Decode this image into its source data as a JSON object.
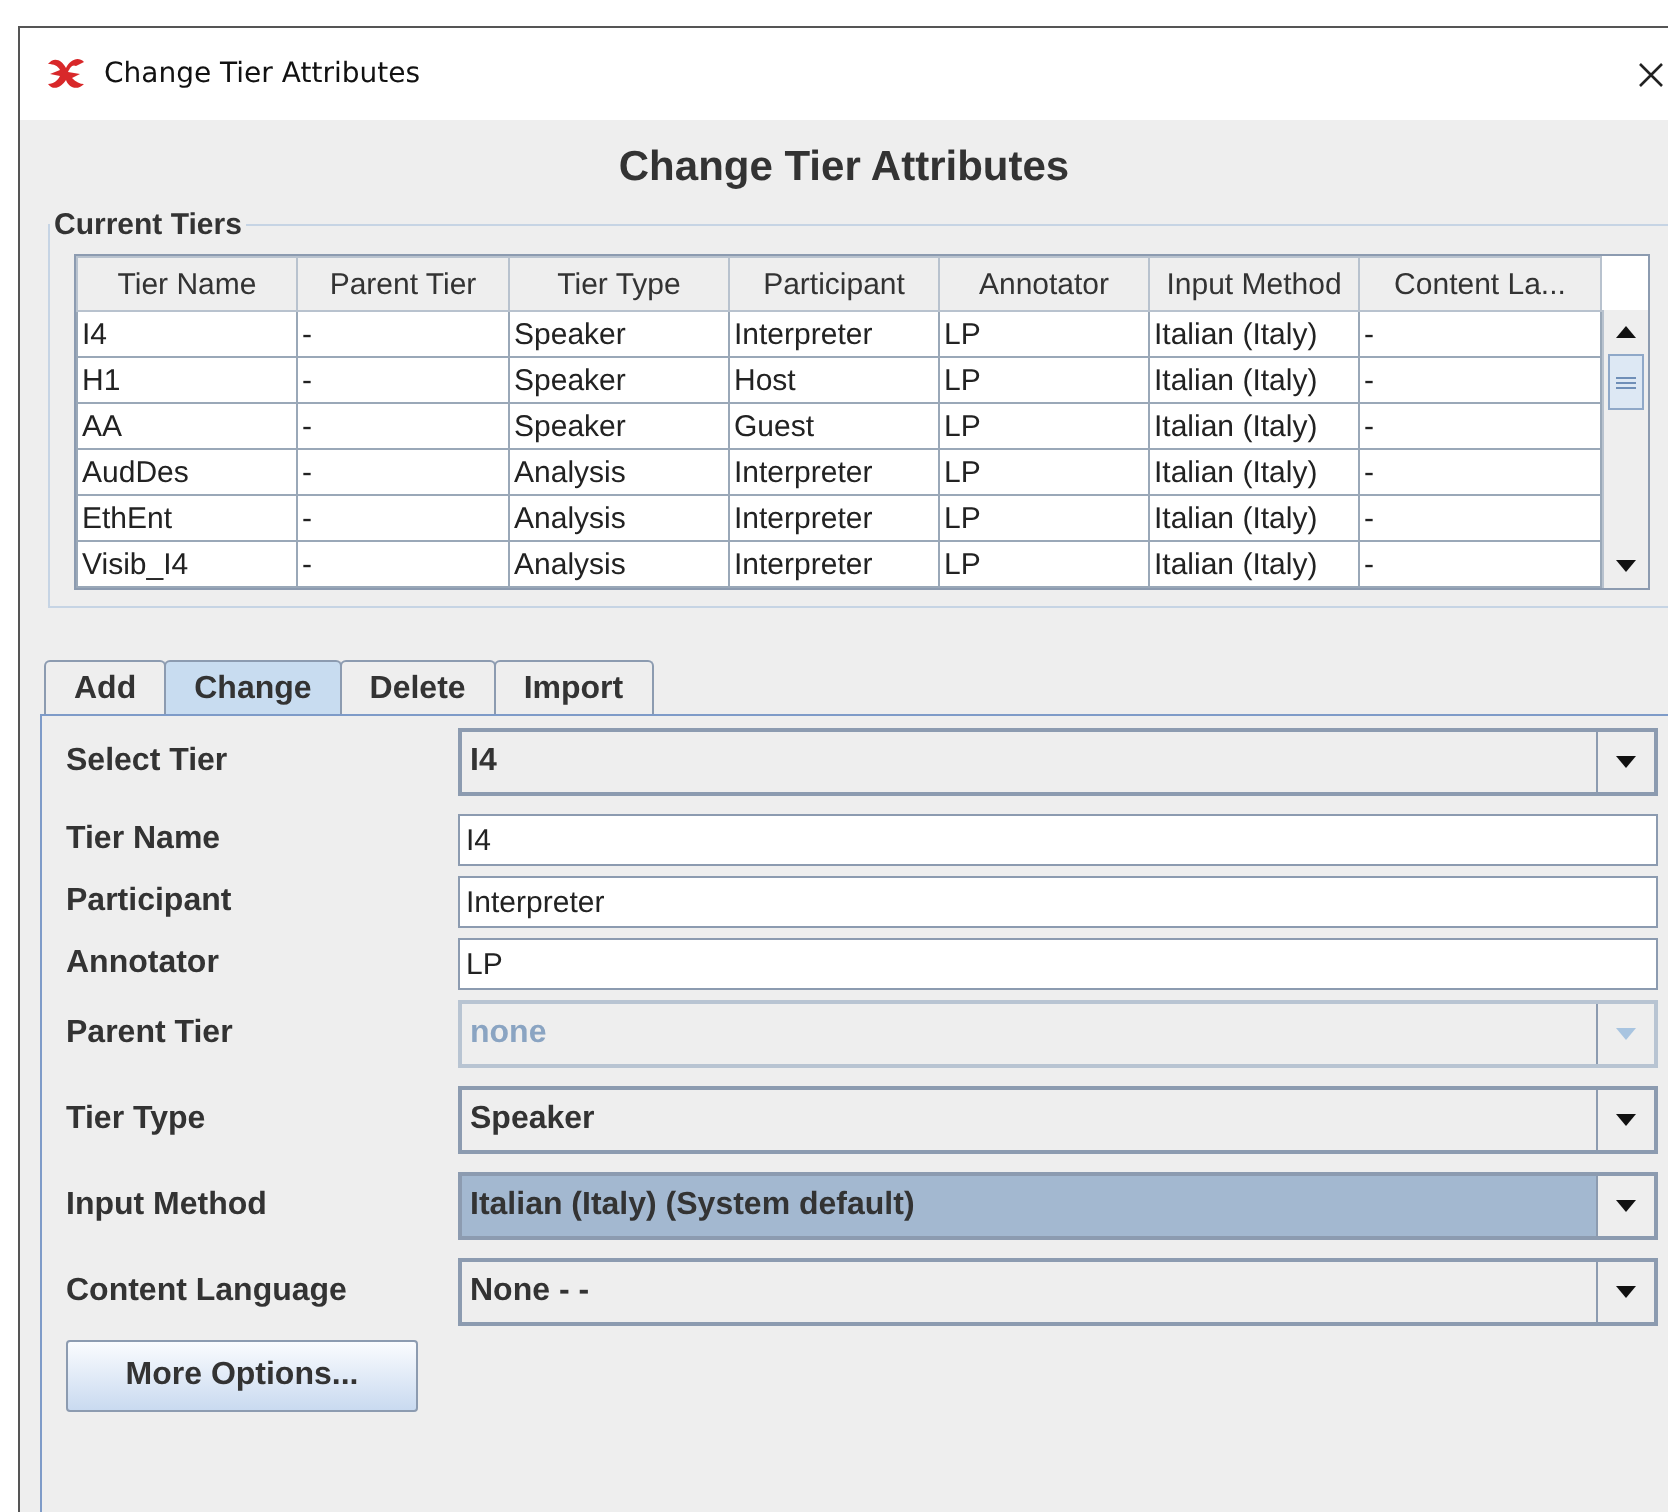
{
  "window": {
    "title": "Change Tier Attributes"
  },
  "heading": "Change Tier Attributes",
  "current_tiers": {
    "title": "Current Tiers",
    "columns": [
      "Tier Name",
      "Parent Tier",
      "Tier Type",
      "Participant",
      "Annotator",
      "Input Method",
      "Content La..."
    ],
    "rows": [
      [
        "I4",
        "-",
        "Speaker",
        "Interpreter",
        "LP",
        "Italian (Italy)",
        "-"
      ],
      [
        "H1",
        "-",
        "Speaker",
        "Host",
        "LP",
        "Italian (Italy)",
        "-"
      ],
      [
        "AA",
        "-",
        "Speaker",
        "Guest",
        "LP",
        "Italian (Italy)",
        "-"
      ],
      [
        "AudDes",
        "-",
        "Analysis",
        "Interpreter",
        "LP",
        "Italian (Italy)",
        "-"
      ],
      [
        "EthEnt",
        "-",
        "Analysis",
        "Interpreter",
        "LP",
        "Italian (Italy)",
        "-"
      ],
      [
        "Visib_I4",
        "-",
        "Analysis",
        "Interpreter",
        "LP",
        "Italian (Italy)",
        "-"
      ]
    ]
  },
  "tabs": [
    {
      "label": "Add",
      "selected": false
    },
    {
      "label": "Change",
      "selected": true
    },
    {
      "label": "Delete",
      "selected": false
    },
    {
      "label": "Import",
      "selected": false
    }
  ],
  "form": [
    {
      "label": "Select Tier",
      "kind": "combo",
      "value": "I4",
      "disabled": false,
      "highlighted": false
    },
    {
      "label": "Tier Name",
      "kind": "text",
      "value": "I4"
    },
    {
      "label": "Participant",
      "kind": "text",
      "value": "Interpreter"
    },
    {
      "label": "Annotator",
      "kind": "text",
      "value": "LP"
    },
    {
      "label": "Parent Tier",
      "kind": "combo",
      "value": "none",
      "disabled": true,
      "highlighted": false
    },
    {
      "label": "Tier Type",
      "kind": "combo",
      "value": "Speaker",
      "disabled": false,
      "highlighted": false
    },
    {
      "label": "Input Method",
      "kind": "combo",
      "value": "Italian (Italy) (System default)",
      "disabled": false,
      "highlighted": true
    },
    {
      "label": "Content Language",
      "kind": "combo",
      "value": "None -  -",
      "disabled": false,
      "highlighted": false
    }
  ],
  "more_options_button": "More Options..."
}
